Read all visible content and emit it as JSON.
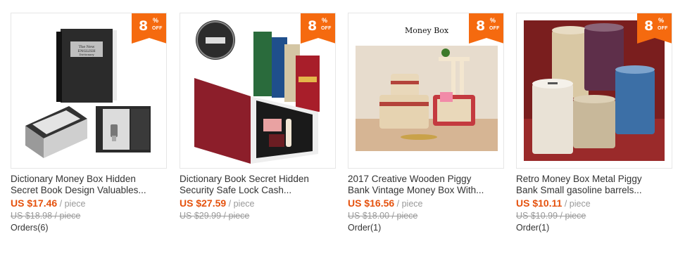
{
  "colors": {
    "accent": "#e5520e",
    "badge": "#f56a0f",
    "muted": "#999999"
  },
  "products": [
    {
      "discount": "8",
      "discount_pct": "%",
      "discount_off": "OFF",
      "title_line1": "Dictionary Money Box Hidden",
      "title_line2": "Secret Book Design Valuables...",
      "price": "US $17.46",
      "unit": " / piece",
      "old_price": "US $18.98 / piece",
      "orders": "Orders(6)"
    },
    {
      "discount": "8",
      "discount_pct": "%",
      "discount_off": "OFF",
      "title_line1": "Dictionary Book Secret Hidden",
      "title_line2": "Security Safe Lock Cash...",
      "price": "US $27.59",
      "unit": " / piece",
      "old_price": "US $29.99 / piece",
      "orders": ""
    },
    {
      "discount": "8",
      "discount_pct": "%",
      "discount_off": "OFF",
      "image_caption": "Money Box",
      "title_line1": "2017 Creative Wooden Piggy",
      "title_line2": "Bank Vintage Money Box With...",
      "price": "US $16.56",
      "unit": " / piece",
      "old_price": "US $18.00 / piece",
      "orders": "Order(1)"
    },
    {
      "discount": "8",
      "discount_pct": "%",
      "discount_off": "OFF",
      "title_line1": "Retro Money Box Metal Piggy",
      "title_line2": "Bank Small gasoline barrels...",
      "price": "US $10.11",
      "unit": " / piece",
      "old_price": "US $10.99 / piece",
      "orders": "Order(1)"
    }
  ]
}
